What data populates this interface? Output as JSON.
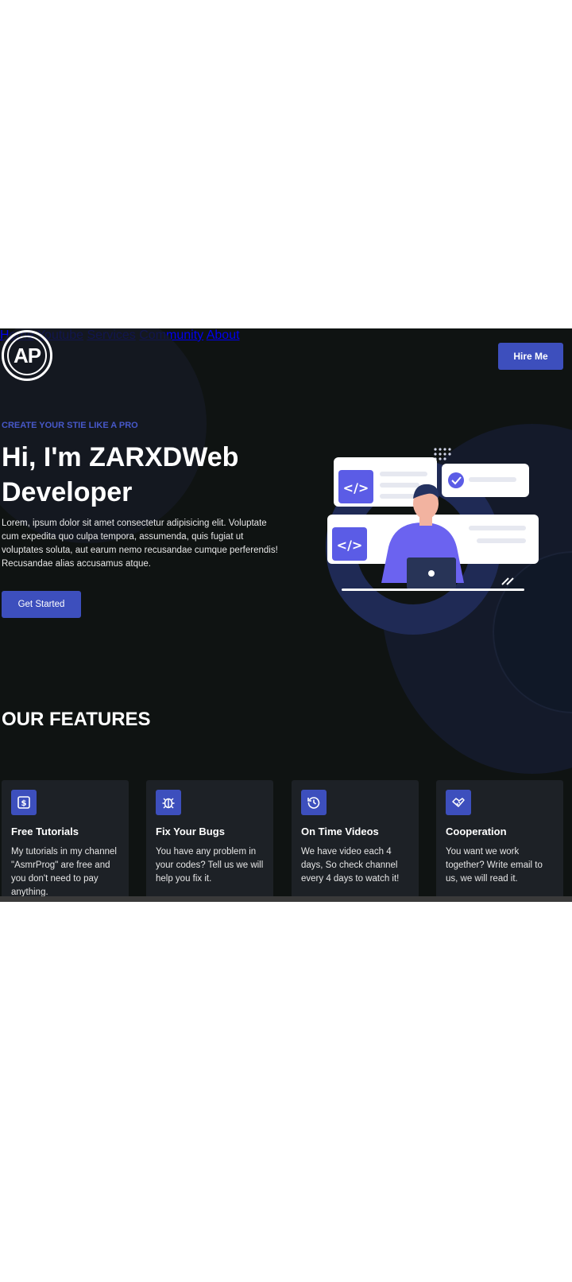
{
  "logo": {
    "text": "AP"
  },
  "nav": {
    "items": [
      "Home",
      "Youtube",
      "Services",
      "Community",
      "About"
    ],
    "cta": "Hire Me"
  },
  "hero": {
    "tagline": "CREATE YOUR STIE LIKE A PRO",
    "greeting": "Hi, I'm",
    "name": "ZARXD",
    "role_rest": "Web",
    "role_line2": "Developer",
    "description": "Lorem, ipsum dolor sit amet consectetur adipisicing elit. Voluptate cum expedita quo culpa tempora, assumenda, quis fugiat ut voluptates soluta, aut earum nemo recusandae cumque perferendis! Recusandae alias accusamus atque.",
    "button": "Get Started"
  },
  "features": {
    "title": "OUR FEATURES",
    "cards": [
      {
        "icon": "dollar-icon",
        "title": "Free Tutorials",
        "desc": "My tutorials in my channel \"AsmrProg\" are free and you don't need to pay anything."
      },
      {
        "icon": "bug-icon",
        "title": "Fix Your Bugs",
        "desc": "You have any problem in your codes? Tell us we will help you fix it."
      },
      {
        "icon": "history-icon",
        "title": "On Time Videos",
        "desc": "We have video each 4 days, So check channel every 4 days to watch it!"
      },
      {
        "icon": "handshake-icon",
        "title": "Cooperation",
        "desc": "You want we work together? Write email to us, we will read it."
      }
    ]
  },
  "colors": {
    "accent": "#3d4fbd",
    "background": "#0f1312",
    "card": "#1d2126"
  }
}
